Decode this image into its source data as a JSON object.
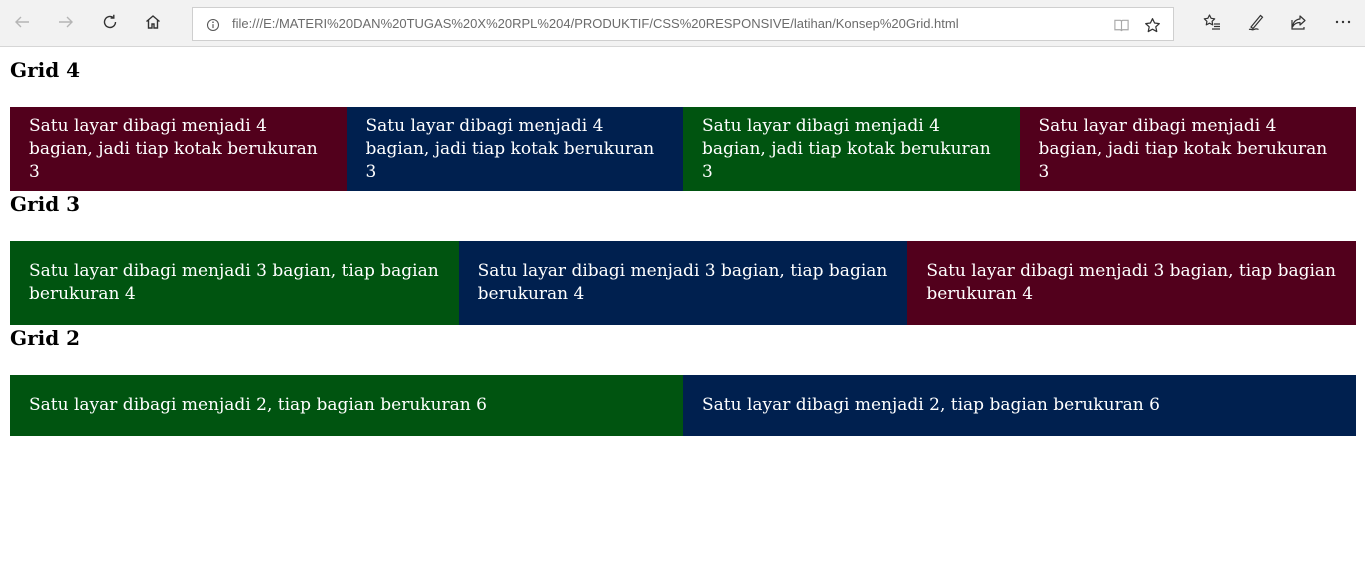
{
  "browser": {
    "url": "file:///E:/MATERI%20DAN%20TUGAS%20X%20RPL%204/PRODUKTIF/CSS%20RESPONSIVE/latihan/Konsep%20Grid.html"
  },
  "colors": {
    "maroon": "#52001c",
    "navy": "#00204f",
    "green": "#005410"
  },
  "sections": {
    "grid4": {
      "title": "Grid 4",
      "cells": [
        {
          "text": "Satu layar dibagi menjadi 4 bagian, jadi tiap kotak berukuran 3",
          "color": "#52001c"
        },
        {
          "text": "Satu layar dibagi menjadi 4 bagian, jadi tiap kotak berukuran 3",
          "color": "#00204f"
        },
        {
          "text": "Satu layar dibagi menjadi 4 bagian, jadi tiap kotak berukuran 3",
          "color": "#005410"
        },
        {
          "text": "Satu layar dibagi menjadi 4 bagian, jadi tiap kotak berukuran 3",
          "color": "#52001c"
        }
      ]
    },
    "grid3": {
      "title": "Grid 3",
      "cells": [
        {
          "text": "Satu layar dibagi menjadi 3 bagian, tiap bagian berukuran 4",
          "color": "#005410"
        },
        {
          "text": "Satu layar dibagi menjadi 3 bagian, tiap bagian berukuran 4",
          "color": "#00204f"
        },
        {
          "text": "Satu layar dibagi menjadi 3 bagian, tiap bagian berukuran 4",
          "color": "#52001c"
        }
      ]
    },
    "grid2": {
      "title": "Grid 2",
      "cells": [
        {
          "text": "Satu layar dibagi menjadi 2, tiap bagian berukuran 6",
          "color": "#005410"
        },
        {
          "text": "Satu layar dibagi menjadi 2, tiap bagian berukuran 6",
          "color": "#00204f"
        }
      ]
    }
  },
  "icons": {
    "back": "back-arrow-icon",
    "forward": "forward-arrow-icon",
    "refresh": "refresh-icon",
    "home": "home-icon",
    "info": "info-icon",
    "reading_view": "reading-view-icon",
    "favorite": "star-icon",
    "favorites_list": "favorites-list-icon",
    "notes": "pen-icon",
    "share": "share-icon",
    "more": "more-icon"
  }
}
